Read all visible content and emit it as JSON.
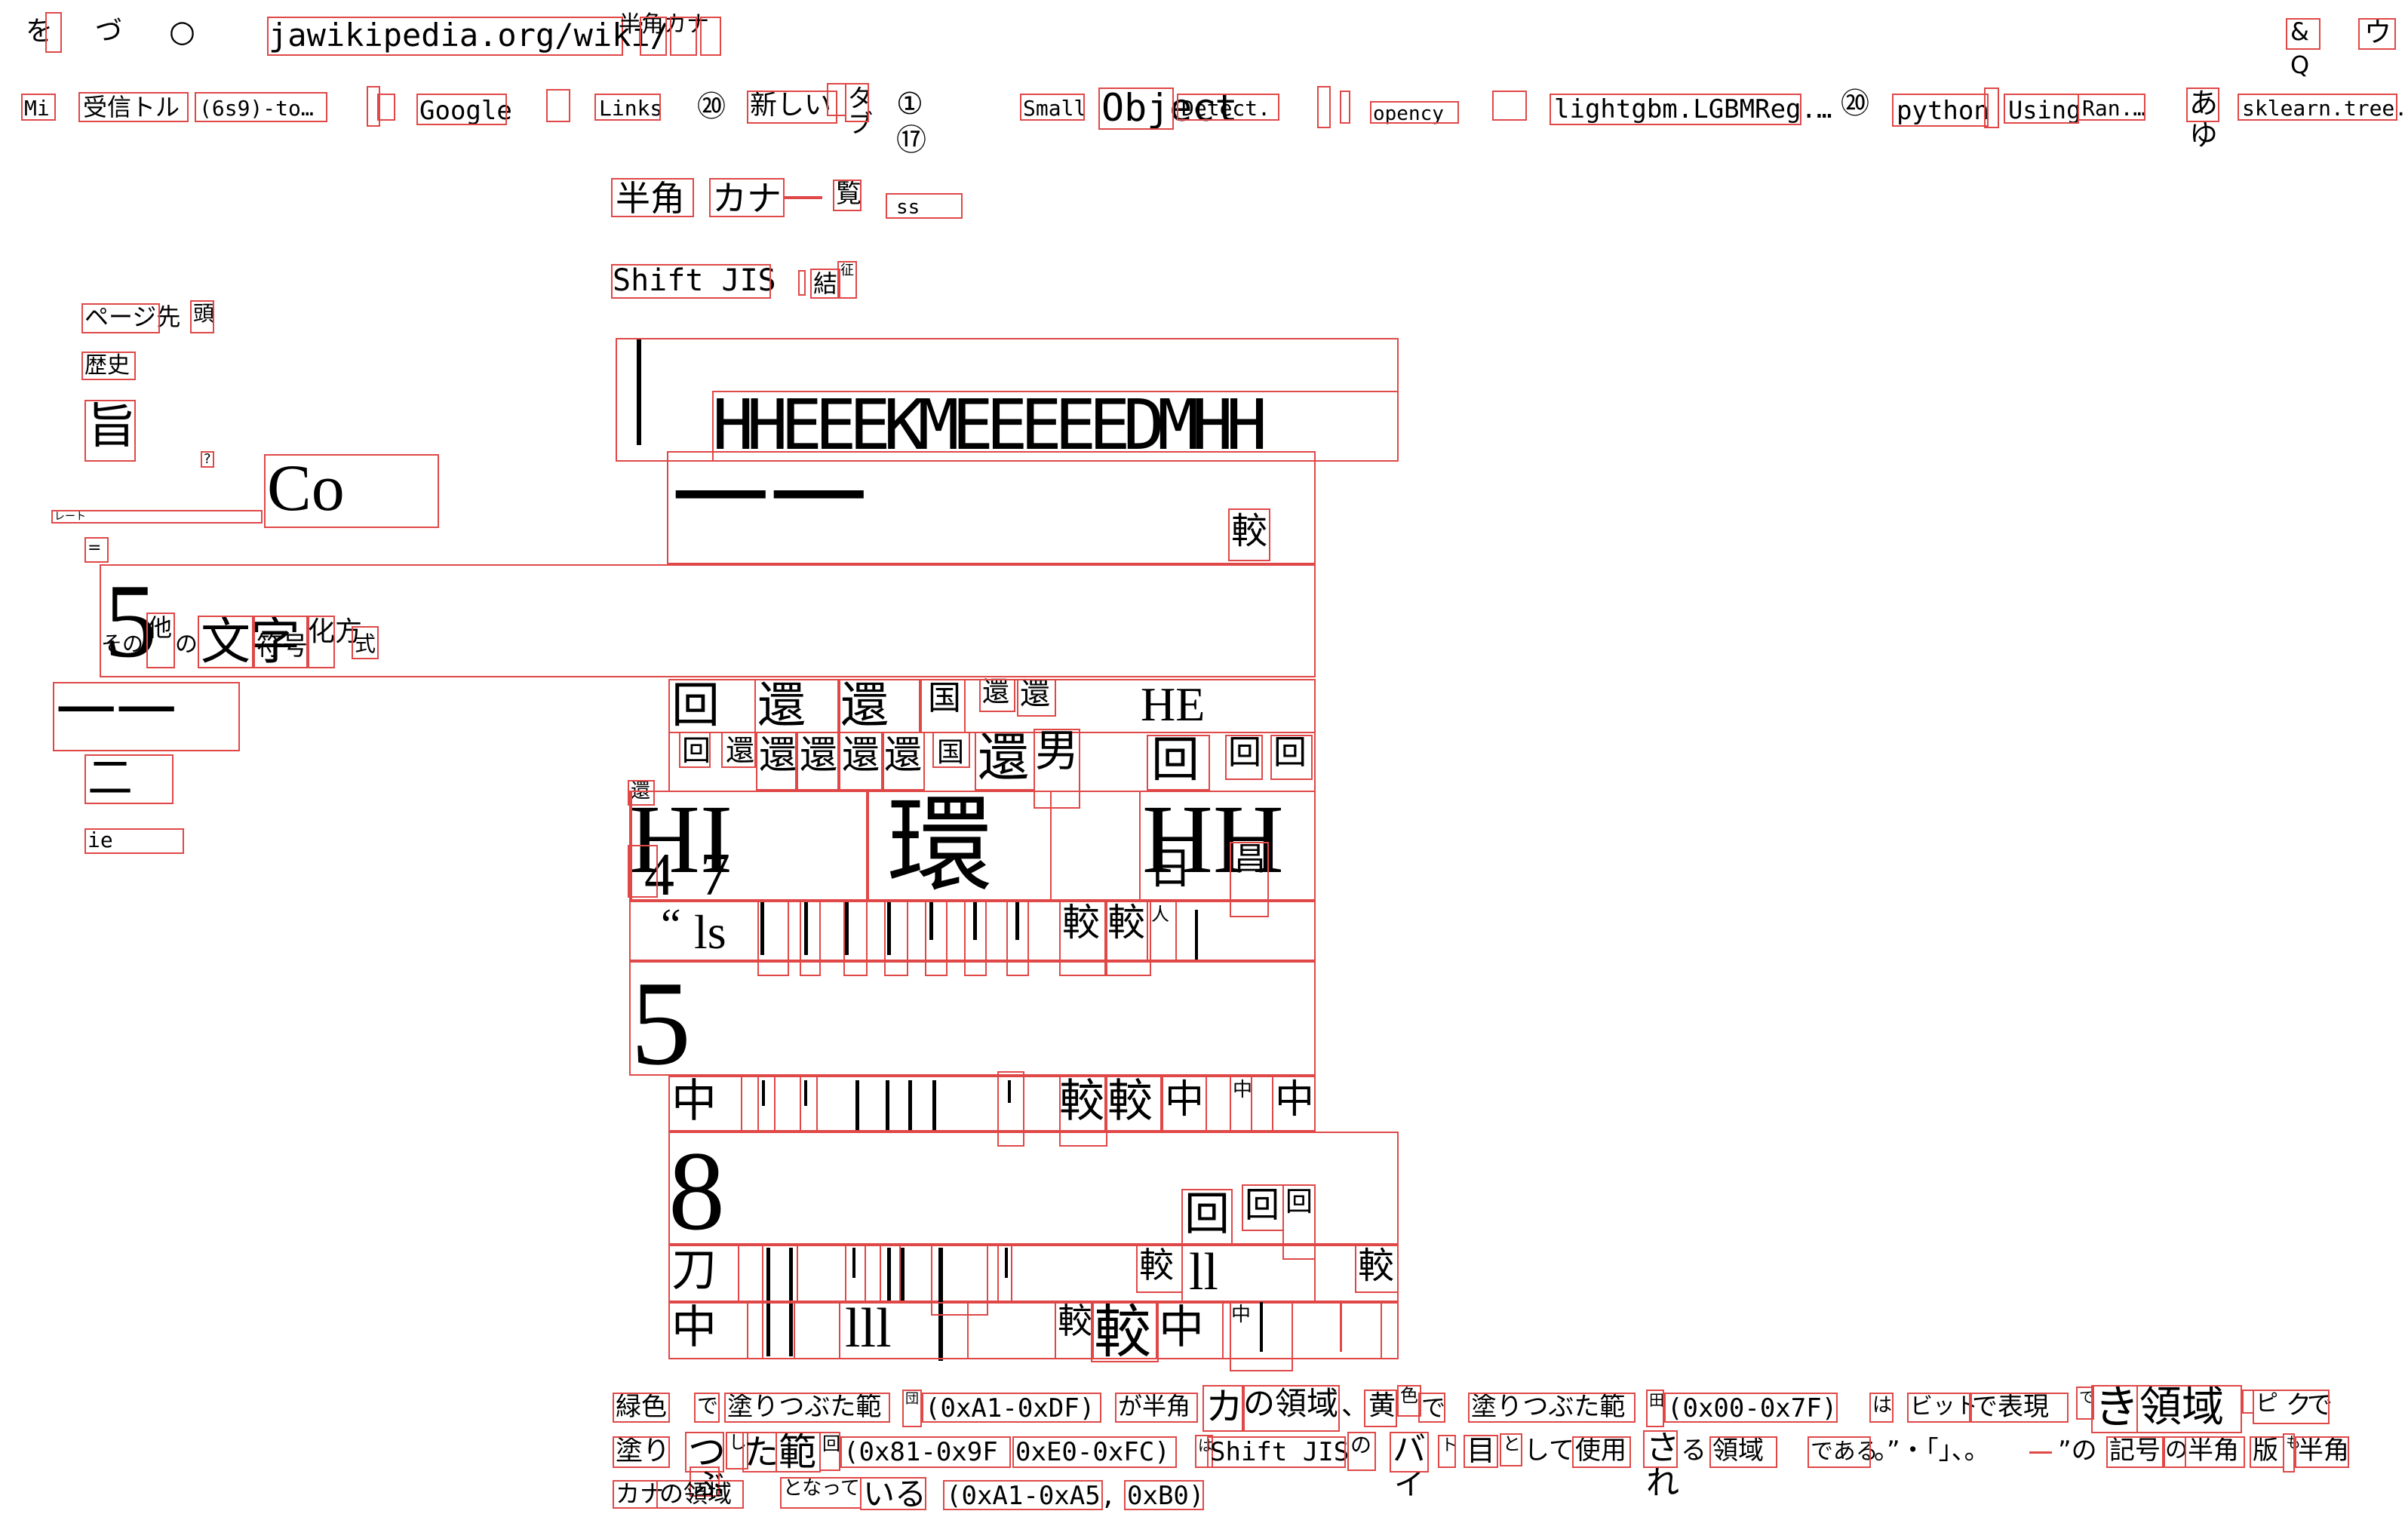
{
  "browser": {
    "nav_glyph_1": "を",
    "nav_glyph_2": "づ",
    "nav_glyph_3": "○",
    "address": "jawikipedia.org/wiki/",
    "address_tail": "半角カナ",
    "right_1": "&",
    "right_1b": "Q",
    "right_2": "ウ"
  },
  "bookmarks": [
    "Mi",
    "受信トル",
    "(6s9)-to…",
    "Google",
    "Links",
    "⑳",
    "新しい",
    "タブ",
    "①",
    "⑰",
    "Small",
    "Object",
    "Detect.",
    "opency",
    "lightgbm.LGBMReg.…",
    "⑳",
    "python",
    "Using",
    "Ran.…",
    "あ",
    "ゆ",
    "sklearn.tree.D"
  ],
  "page": {
    "heading_1": "半角",
    "heading_2": "カナ",
    "heading_3": "覧",
    "heading_4": "ss",
    "sub_1": "Shift JIS",
    "sub_2": "結",
    "sub_3": "征"
  },
  "sidebar": {
    "item_1a": "ページ先",
    "item_1b": "頭",
    "item_2": "歴史",
    "item_3": "旨",
    "item_4": "?",
    "item_5": "Co",
    "item_6": "レート",
    "item_7": "=",
    "item_8a": "その",
    "item_8b": "他",
    "item_8c": "の",
    "item_8d": "文字",
    "item_8e": "符号",
    "item_8f": "化方",
    "item_8g": "式",
    "item_9": "一一",
    "item_10": "二",
    "item_11": "ie",
    "digit_5": "5"
  },
  "table": {
    "header_text": "HHEEEKMEEEEEDMHH",
    "header_big": "一一",
    "header_right": "較",
    "row1": [
      "回",
      "還",
      "還",
      "国",
      "還",
      "還",
      "HE"
    ],
    "row2": [
      "回",
      "還",
      "還",
      "還",
      "還",
      "還",
      "国",
      "還",
      "男",
      "回",
      "回",
      "回"
    ],
    "row3_small": "還",
    "row3": [
      "HI",
      "4",
      "7",
      "環",
      "HH",
      "日",
      "昌"
    ],
    "row4": [
      "“",
      "ls",
      "較",
      "較",
      "人"
    ],
    "row5_digit": "5",
    "row6": [
      "中",
      "較",
      "較",
      "中",
      "中",
      "中"
    ],
    "row7_digit": "8",
    "row7_right": [
      "回",
      "回",
      "回"
    ],
    "row8": [
      "刀",
      "較",
      "ll",
      "較"
    ],
    "row9": [
      "中",
      "lll",
      "較",
      "較",
      "中",
      "中"
    ]
  },
  "footer": {
    "line1": [
      "緑色",
      "で",
      "塗りつぶた範",
      "団",
      "(0xA1-0xDF)",
      "が半角",
      "カ",
      "の領域",
      "、黄",
      "色",
      "で",
      "塗りつぶた範",
      "田",
      "(0x00-0x7F)",
      "は",
      "ビット",
      "で表現",
      "で",
      "き",
      "領域",
      "ピ",
      "ク",
      "で"
    ],
    "line2": [
      "塗り",
      "つ",
      "ぶ",
      "し",
      "た",
      "範",
      "回",
      "(0x81-0x9F",
      "0xE0-0xFC)",
      "は",
      "Shift JIS",
      "の",
      "バ",
      "イ",
      "ト",
      "目",
      "と",
      "して",
      "使用",
      "さ",
      "れ",
      "る",
      "領域",
      "である",
      "。”・「」、。",
      "”の",
      "記号",
      "の",
      "半角",
      "版",
      "も",
      "半角"
    ],
    "line3": [
      "カナ",
      "の領域",
      "となって",
      "いる",
      "(0xA1-0xA5,",
      "0xB0)"
    ]
  },
  "colors": {
    "accent": "#e04848"
  }
}
